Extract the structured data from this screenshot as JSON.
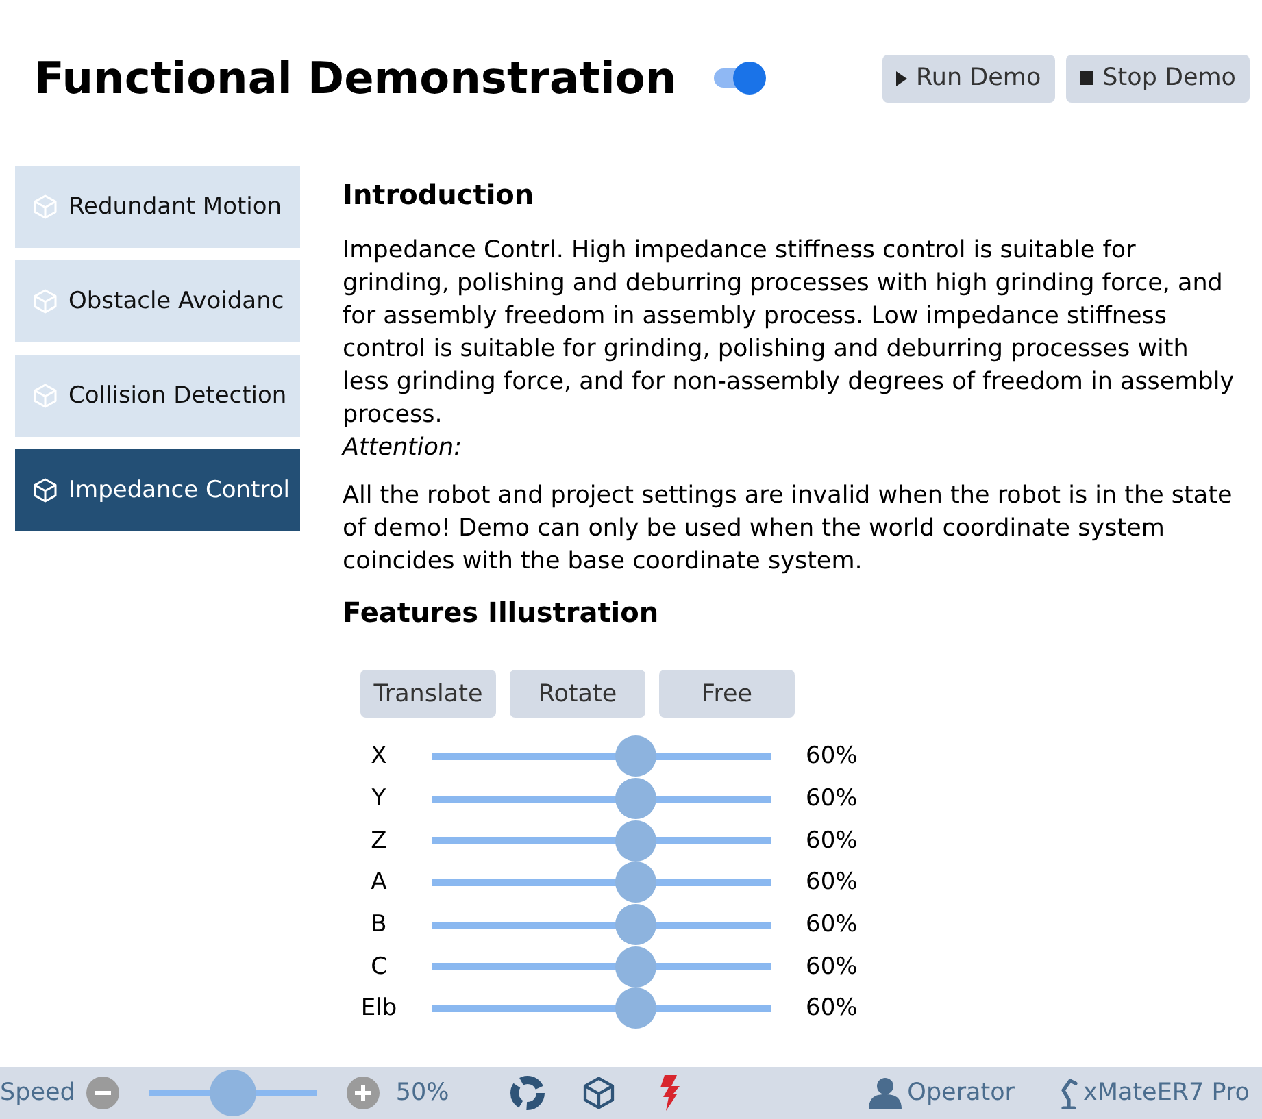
{
  "header": {
    "title": "Functional Demonstration",
    "demo_toggle": {
      "on": true
    },
    "buttons": [
      {
        "kind": "run",
        "label": "Run Demo"
      },
      {
        "kind": "stop",
        "label": "Stop Demo"
      }
    ]
  },
  "sidebar": {
    "items": [
      {
        "label": "Redundant Motion",
        "selected": false
      },
      {
        "label": "Obstacle Avoidanc",
        "selected": false
      },
      {
        "label": "Collision Detection",
        "selected": false
      },
      {
        "label": "Impedance Control",
        "selected": true
      }
    ]
  },
  "introduction": {
    "heading": "Introduction",
    "paragraphs": [
      {
        "kind": "body",
        "text": "Impedance Contrl. High impedance stiffness control is suitable for grinding, polishing and deburring processes with high grinding force, and for assembly freedom in assembly process. Low impedance stiffness control is suitable for grinding, polishing and deburring processes with less grinding force, and for non-assembly degrees of freedom in assembly process."
      },
      {
        "kind": "note_label",
        "text": "Attention:"
      },
      {
        "kind": "body",
        "text": "All the robot and project settings are invalid when the robot is in the state of demo! Demo can only be used when the world coordinate system coincides with the base coordinate system."
      }
    ]
  },
  "features": {
    "heading": "Features Illustration",
    "modes": [
      {
        "label": "Translate",
        "selected": false
      },
      {
        "label": "Rotate",
        "selected": false
      },
      {
        "label": "Free",
        "selected": false
      }
    ],
    "sliders": [
      {
        "label": "X",
        "level": 0.6,
        "reading": "60%"
      },
      {
        "label": "Y",
        "level": 0.6,
        "reading": "60%"
      },
      {
        "label": "Z",
        "level": 0.6,
        "reading": "60%"
      },
      {
        "label": "A",
        "level": 0.6,
        "reading": "60%"
      },
      {
        "label": "B",
        "level": 0.6,
        "reading": "60%"
      },
      {
        "label": "C",
        "level": 0.6,
        "reading": "60%"
      },
      {
        "label": "Elb",
        "level": 0.6,
        "reading": "60%"
      }
    ]
  },
  "status_bar": {
    "speed": {
      "label": "Speed",
      "level": 0.5,
      "reading": "50%"
    },
    "user": "Operator",
    "robot": "xMateER7 Pro"
  }
}
